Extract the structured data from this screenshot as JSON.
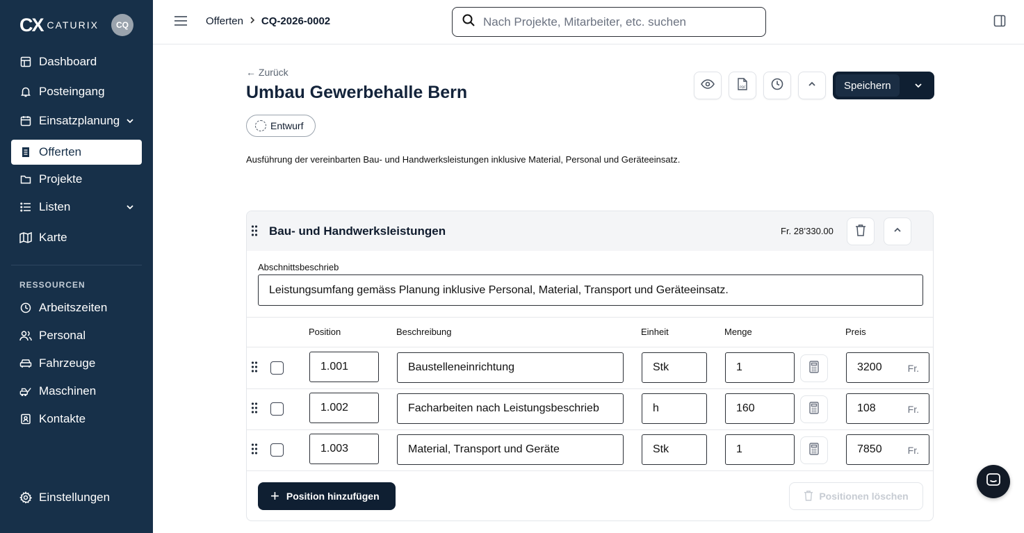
{
  "app": {
    "logo_mark": "CX",
    "logo_text": "CATURIX",
    "user_initials": "CQ"
  },
  "sidebar": {
    "items": [
      {
        "label": "Dashboard",
        "icon": "dashboard-icon"
      },
      {
        "label": "Posteingang",
        "icon": "bell-icon"
      },
      {
        "label": "Einsatzplanung",
        "icon": "calendar-icon",
        "expandable": true
      },
      {
        "label": "Offerten",
        "icon": "document-icon",
        "active": true
      },
      {
        "label": "Projekte",
        "icon": "folder-icon"
      },
      {
        "label": "Listen",
        "icon": "list-icon",
        "expandable": true
      },
      {
        "label": "Karte",
        "icon": "map-icon"
      }
    ],
    "section_label": "RESSOURCEN",
    "resources": [
      {
        "label": "Arbeitszeiten",
        "icon": "clock-icon"
      },
      {
        "label": "Personal",
        "icon": "people-icon"
      },
      {
        "label": "Fahrzeuge",
        "icon": "car-icon"
      },
      {
        "label": "Maschinen",
        "icon": "machine-icon"
      },
      {
        "label": "Kontakte",
        "icon": "contact-icon"
      }
    ],
    "settings_label": "Einstellungen"
  },
  "topbar": {
    "breadcrumb": [
      "Offerten",
      "CQ-2026-0002"
    ],
    "search_placeholder": "Nach Projekte, Mitarbeiter, etc. suchen"
  },
  "page": {
    "back_label": "Zurück",
    "title": "Umbau Gewerbehalle Bern",
    "status": "Entwurf",
    "description": "Ausführung der vereinbarten Bau- und Handwerksleistungen inklusive Material, Personal und Geräteeinsatz.",
    "save_label": "Speichern"
  },
  "section": {
    "title": "Bau- und Handwerksleistungen",
    "total": "Fr. 28’330.00",
    "description_label": "Abschnittsbeschrieb",
    "description_value": "Leistungsumfang gemäss Planung inklusive Personal, Material, Transport und Geräteeinsatz.",
    "columns": {
      "position": "Position",
      "description": "Beschreibung",
      "unit": "Einheit",
      "quantity": "Menge",
      "price": "Preis"
    },
    "currency": "Fr.",
    "rows": [
      {
        "position": "1.001",
        "description": "Baustelleneinrichtung",
        "unit": "Stk",
        "quantity": "1",
        "price": "3200"
      },
      {
        "position": "1.002",
        "description": "Facharbeiten nach Leistungsbeschrieb",
        "unit": "h",
        "quantity": "160",
        "price": "108"
      },
      {
        "position": "1.003",
        "description": "Material, Transport und Geräte",
        "unit": "Stk",
        "quantity": "1",
        "price": "7850"
      }
    ],
    "add_label": "Position hinzufügen",
    "delete_label": "Positionen löschen"
  },
  "colors": {
    "sidebar_bg": "#173049",
    "primary_button": "#0f1f32"
  }
}
